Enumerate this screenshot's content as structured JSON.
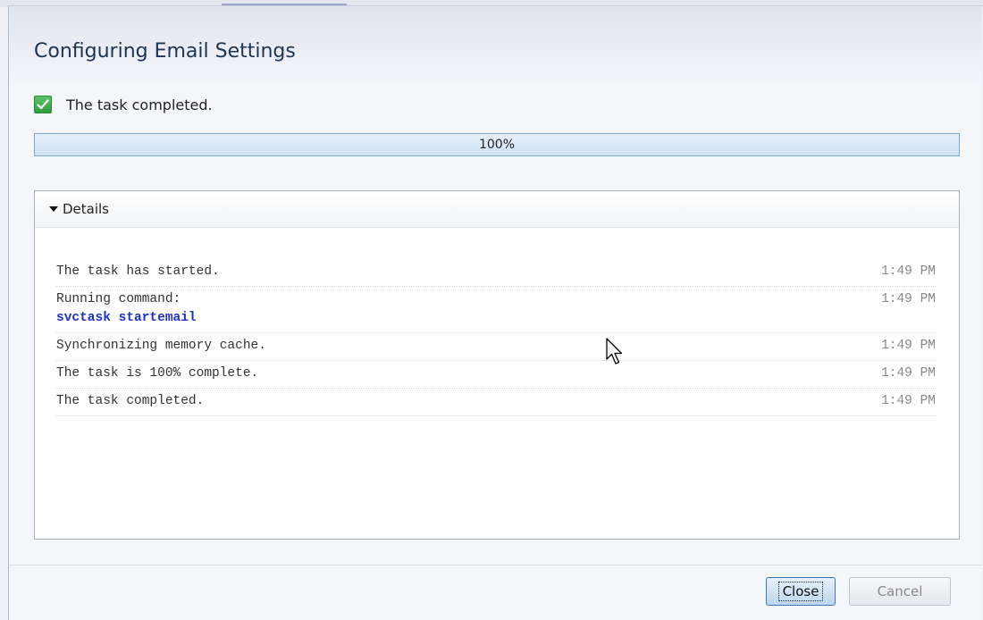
{
  "dialog": {
    "title": "Configuring Email Settings",
    "status_text": "The task completed.",
    "progress": {
      "percent": 100,
      "label": "100%"
    },
    "details": {
      "label": "Details",
      "expanded": true,
      "log": [
        {
          "message": "The task has started.",
          "time": "1:49 PM"
        },
        {
          "message": "Running command:",
          "command": "svctask startemail",
          "time": "1:49 PM"
        },
        {
          "message": "Synchronizing memory cache.",
          "time": "1:49 PM"
        },
        {
          "message": "The task is 100% complete.",
          "time": "1:49 PM"
        },
        {
          "message": "The task completed.",
          "time": "1:49 PM"
        }
      ]
    },
    "buttons": {
      "close": "Close",
      "cancel": "Cancel"
    }
  },
  "colors": {
    "title": "#1e3552",
    "check": "#2f9c3e",
    "progress_border": "#7aa7cf",
    "command": "#1f2fd0",
    "time": "#888888"
  },
  "icons": {
    "status": "check-icon",
    "details_toggle": "triangle-down-icon",
    "pointer": "mouse-cursor-icon"
  }
}
